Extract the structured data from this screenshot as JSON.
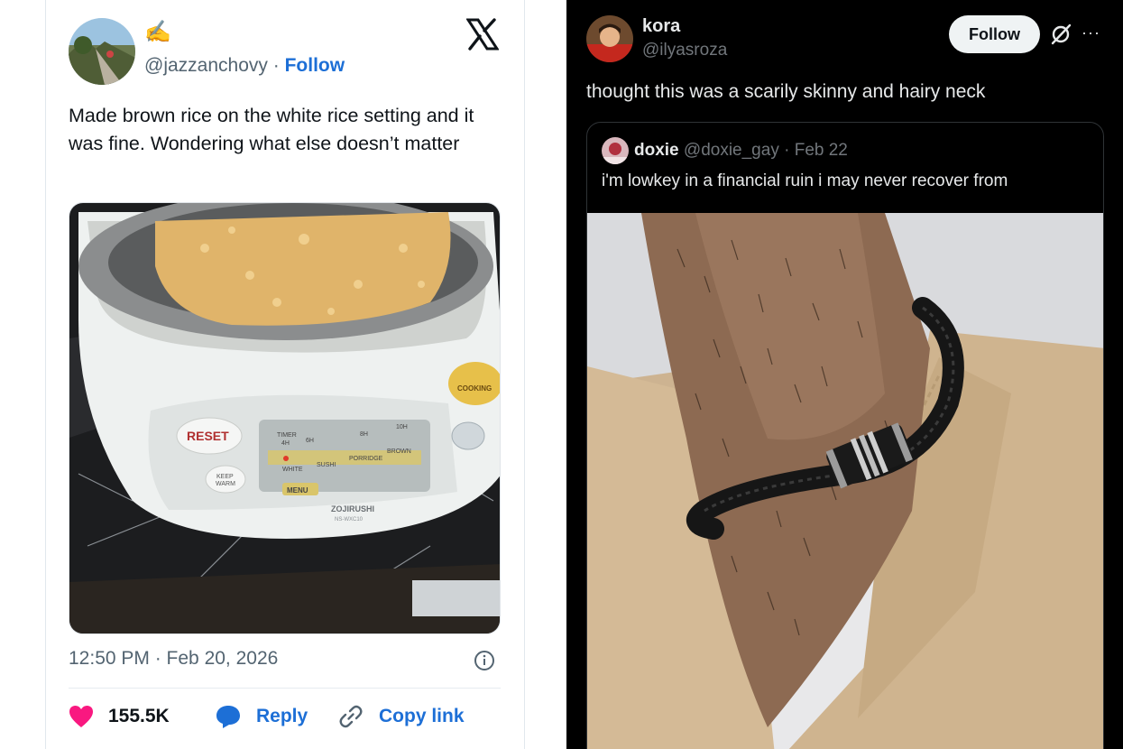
{
  "left_tweet": {
    "emoji": "✍",
    "handle": "@jazzanchovy",
    "separator": "·",
    "follow_label": "Follow",
    "text": "Made brown rice on the white rice setting and it was fine. Wondering what else doesn’t matter",
    "time": "12:50 PM · Feb 20, 2026",
    "actions": {
      "likes": "155.5K",
      "reply_label": "Reply",
      "copy_label": "Copy link"
    },
    "image_text": {
      "reset": "RESET",
      "keep_warm_1": "KEEP",
      "keep_warm_2": "WARM",
      "cooking": "COOKING",
      "timer_1": "TIMER",
      "timer_2": "4H",
      "h6": "6H",
      "h8": "8H",
      "h10": "10H",
      "white": "WHITE",
      "sushi": "SUSHI",
      "porridge": "PORRIDGE",
      "brown": "BROWN",
      "menu": "MENU",
      "brand": "ZOJIRUSHI",
      "model": "NS-WXC10"
    },
    "icons": [
      "x-logo-icon",
      "info-icon",
      "heart-icon",
      "reply-bubble-icon",
      "link-icon"
    ],
    "colors": {
      "heart": "#f91880",
      "link": "#1d6fd6"
    }
  },
  "right_tweet": {
    "name": "kora",
    "handle": "@ilyasroza",
    "follow_label": "Follow",
    "more_label": "···",
    "text": "thought this was a scarily skinny and hairy neck",
    "quote": {
      "name": "doxie",
      "handle": "@doxie_gay",
      "date": "· Feb 22",
      "text": "i'm lowkey in a financial ruin i may never recover from"
    },
    "icons": [
      "grok-icon",
      "more-icon"
    ]
  }
}
